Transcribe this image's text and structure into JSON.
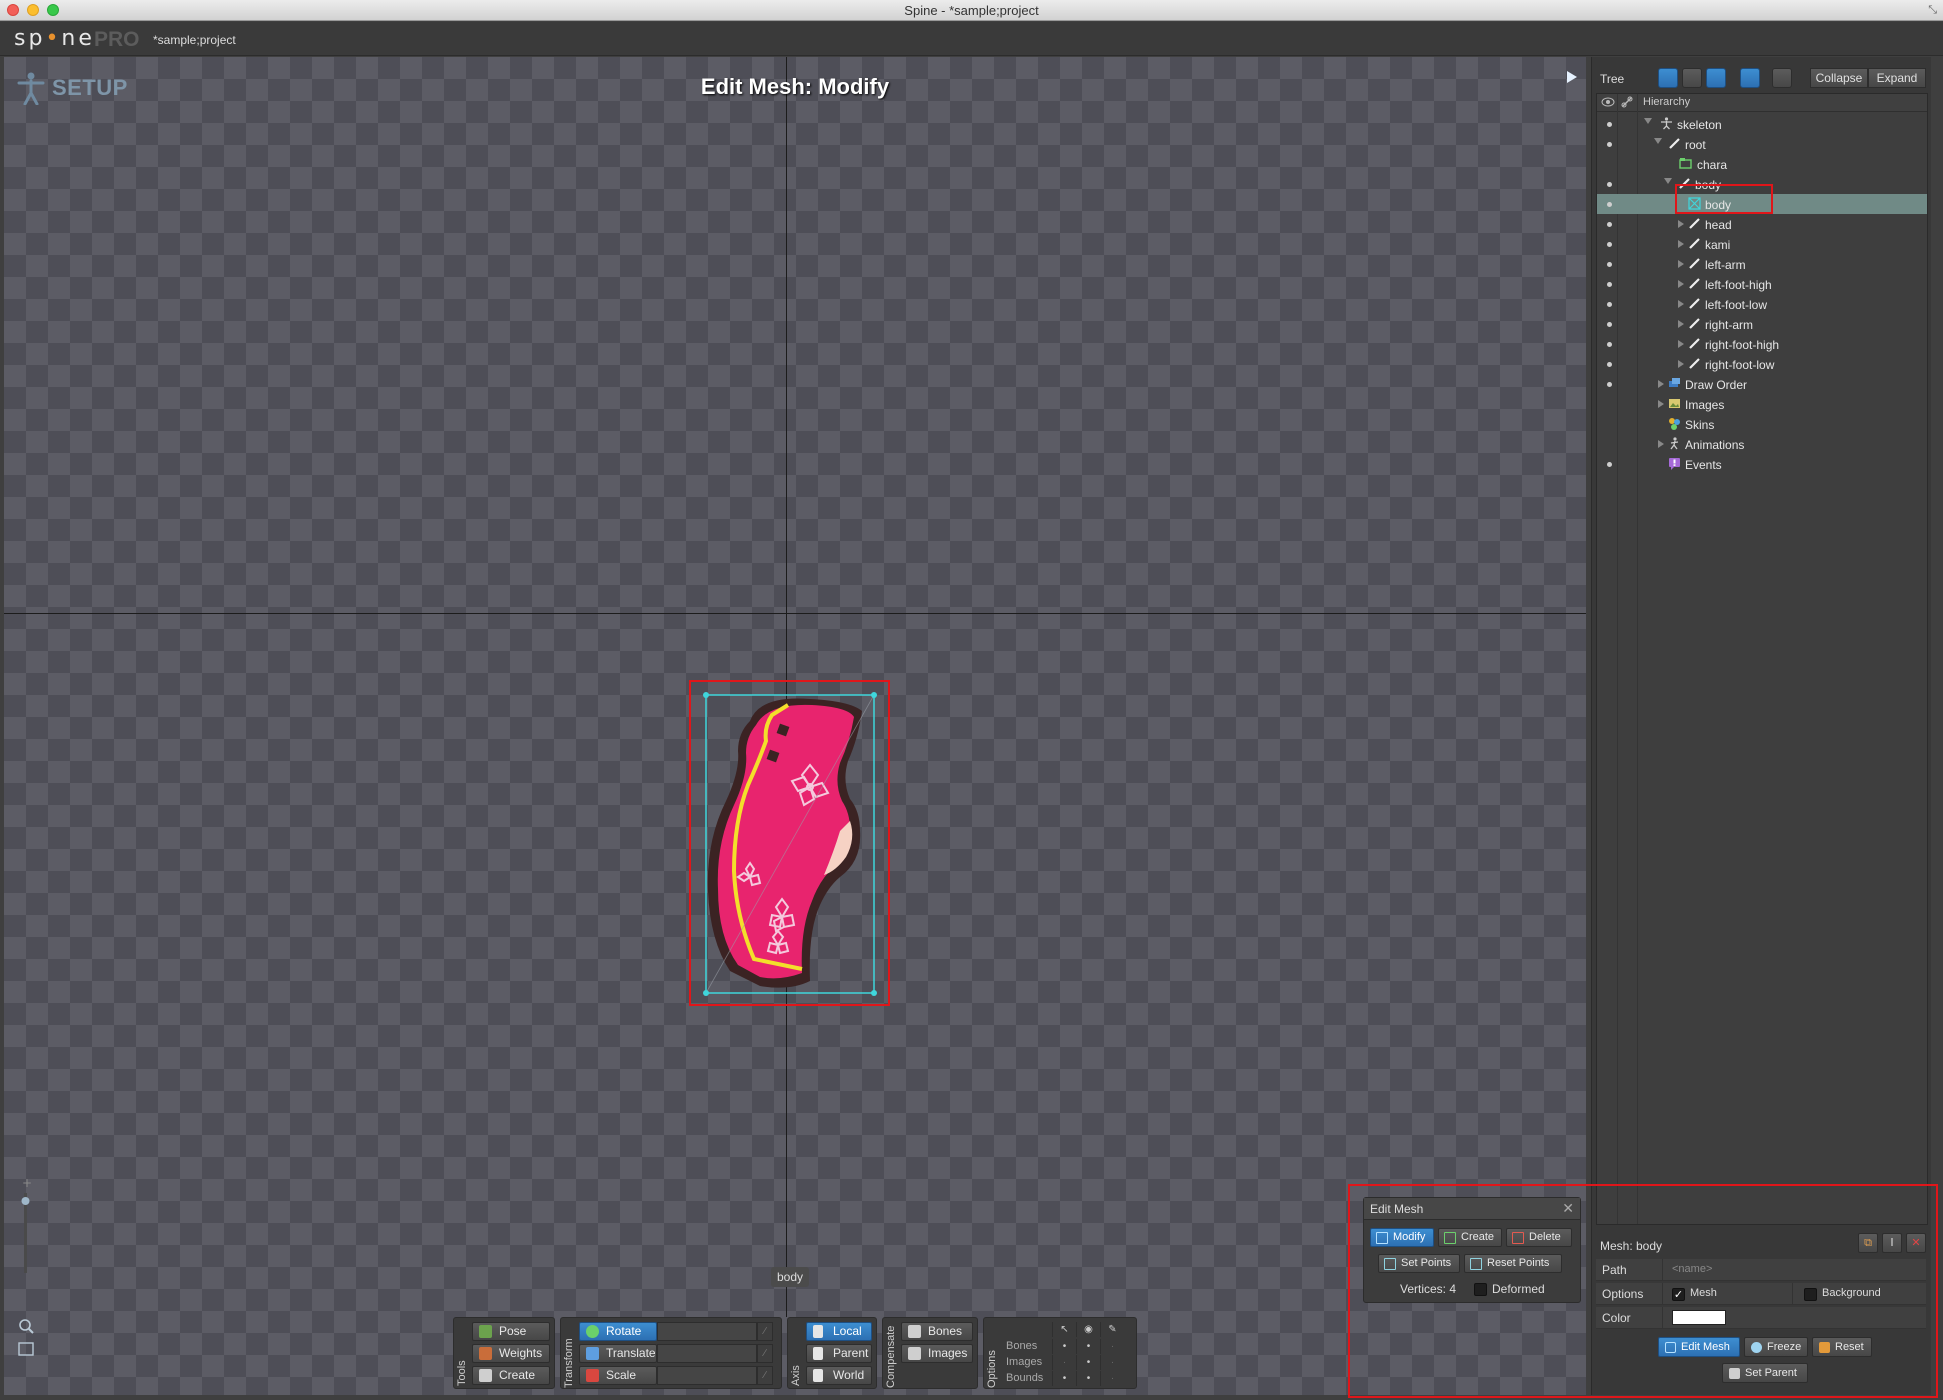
{
  "window": {
    "title": "Spine - *sample;project"
  },
  "app": {
    "logo": "sp•ne",
    "edition": "PRO",
    "project": "*sample;project"
  },
  "viewport": {
    "mode_label": "SETUP",
    "title": "Edit Mesh: Modify",
    "mesh_tag": "body"
  },
  "tools": {
    "tools_label": "Tools",
    "pose": "Pose",
    "weights": "Weights",
    "create": "Create",
    "transform_label": "Transform",
    "rotate": "Rotate",
    "translate": "Translate",
    "scale": "Scale",
    "axis_label": "Axis",
    "local": "Local",
    "parent": "Parent",
    "world": "World",
    "compensate_label": "Compensate",
    "bones": "Bones",
    "images": "Images",
    "options_label": "Options",
    "options_rows": [
      "Bones",
      "Images",
      "Bounds"
    ]
  },
  "edit_mesh": {
    "title": "Edit Mesh",
    "modify": "Modify",
    "create": "Create",
    "delete": "Delete",
    "set_points": "Set Points",
    "reset_points": "Reset Points",
    "vertices": "Vertices: 4",
    "deformed": "Deformed"
  },
  "tree": {
    "label": "Tree",
    "collapse": "Collapse",
    "expand": "Expand",
    "hierarchy": "Hierarchy",
    "items": [
      {
        "label": "skeleton"
      },
      {
        "label": "root"
      },
      {
        "label": "chara"
      },
      {
        "label": "body"
      },
      {
        "label": "body"
      },
      {
        "label": "head"
      },
      {
        "label": "kami"
      },
      {
        "label": "left-arm"
      },
      {
        "label": "left-foot-high"
      },
      {
        "label": "left-foot-low"
      },
      {
        "label": "right-arm"
      },
      {
        "label": "right-foot-high"
      },
      {
        "label": "right-foot-low"
      },
      {
        "label": "Draw Order"
      },
      {
        "label": "Images"
      },
      {
        "label": "Skins"
      },
      {
        "label": "Animations"
      },
      {
        "label": "Events"
      }
    ]
  },
  "properties": {
    "header": "Mesh: body",
    "path_label": "Path",
    "path_placeholder": "<name>",
    "options_label": "Options",
    "mesh_option": "Mesh",
    "background_option": "Background",
    "color_label": "Color",
    "color_value": "#ffffff",
    "edit_mesh": "Edit Mesh",
    "freeze": "Freeze",
    "reset": "Reset",
    "set_parent": "Set Parent"
  },
  "colors": {
    "accent": "#2d7fc9",
    "selection": "#708a86",
    "highlight": "#e0161a"
  }
}
